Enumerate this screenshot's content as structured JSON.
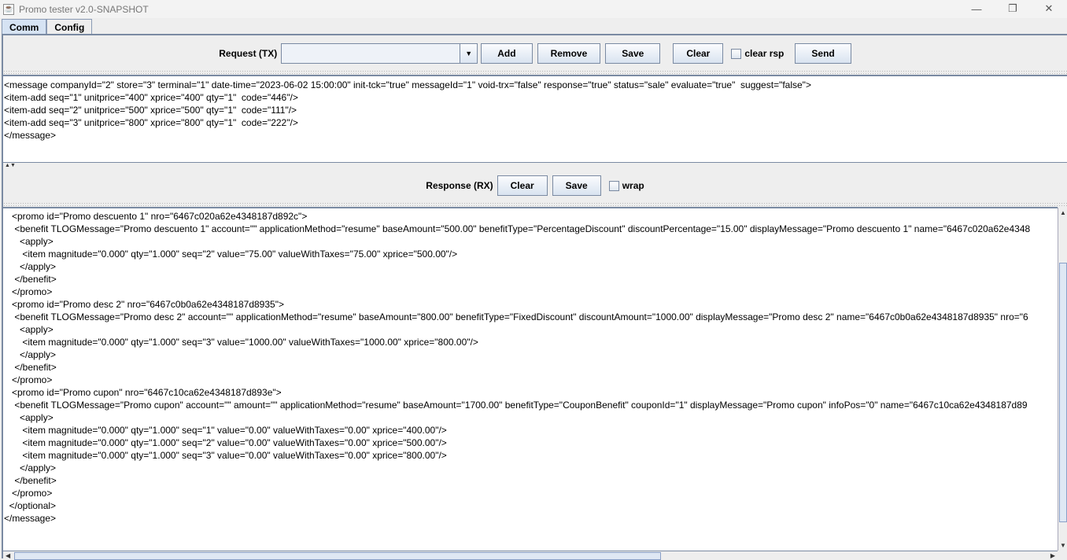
{
  "window": {
    "title": "Promo tester v2.0-SNAPSHOT",
    "minimize": "—",
    "restore": "❐",
    "close": "✕"
  },
  "tabs": [
    {
      "label": "Comm",
      "active": true
    },
    {
      "label": "Config",
      "active": false
    }
  ],
  "request": {
    "label": "Request (TX)",
    "combo_value": "",
    "buttons": {
      "add": "Add",
      "remove": "Remove",
      "save": "Save",
      "clear": "Clear",
      "send": "Send"
    },
    "clear_rsp": {
      "label": "clear rsp",
      "checked": false
    },
    "text": "<message companyId=\"2\" store=\"3\" terminal=\"1\" date-time=\"2023-06-02 15:00:00\" init-tck=\"true\" messageId=\"1\" void-trx=\"false\" response=\"true\" status=\"sale\" evaluate=\"true\"  suggest=\"false\">\n<item-add seq=\"1\" unitprice=\"400\" xprice=\"400\" qty=\"1\"  code=\"446\"/>\n<item-add seq=\"2\" unitprice=\"500\" xprice=\"500\" qty=\"1\"  code=\"111\"/>\n<item-add seq=\"3\" unitprice=\"800\" xprice=\"800\" qty=\"1\"  code=\"222\"/>\n</message>"
  },
  "response": {
    "label": "Response (RX)",
    "buttons": {
      "clear": "Clear",
      "save": "Save"
    },
    "wrap": {
      "label": "wrap",
      "checked": false
    },
    "text": "   <promo id=\"Promo descuento 1\" nro=\"6467c020a62e4348187d892c\">\n    <benefit TLOGMessage=\"Promo descuento 1\" account=\"\" applicationMethod=\"resume\" baseAmount=\"500.00\" benefitType=\"PercentageDiscount\" discountPercentage=\"15.00\" displayMessage=\"Promo descuento 1\" name=\"6467c020a62e4348\n      <apply>\n       <item magnitude=\"0.000\" qty=\"1.000\" seq=\"2\" value=\"75.00\" valueWithTaxes=\"75.00\" xprice=\"500.00\"/>\n      </apply>\n    </benefit>\n   </promo>\n   <promo id=\"Promo desc 2\" nro=\"6467c0b0a62e4348187d8935\">\n    <benefit TLOGMessage=\"Promo desc 2\" account=\"\" applicationMethod=\"resume\" baseAmount=\"800.00\" benefitType=\"FixedDiscount\" discountAmount=\"1000.00\" displayMessage=\"Promo desc 2\" name=\"6467c0b0a62e4348187d8935\" nro=\"6\n      <apply>\n       <item magnitude=\"0.000\" qty=\"1.000\" seq=\"3\" value=\"1000.00\" valueWithTaxes=\"1000.00\" xprice=\"800.00\"/>\n      </apply>\n    </benefit>\n   </promo>\n   <promo id=\"Promo cupon\" nro=\"6467c10ca62e4348187d893e\">\n    <benefit TLOGMessage=\"Promo cupon\" account=\"\" amount=\"\" applicationMethod=\"resume\" baseAmount=\"1700.00\" benefitType=\"CouponBenefit\" couponId=\"1\" displayMessage=\"Promo cupon\" infoPos=\"0\" name=\"6467c10ca62e4348187d89\n      <apply>\n       <item magnitude=\"0.000\" qty=\"1.000\" seq=\"1\" value=\"0.00\" valueWithTaxes=\"0.00\" xprice=\"400.00\"/>\n       <item magnitude=\"0.000\" qty=\"1.000\" seq=\"2\" value=\"0.00\" valueWithTaxes=\"0.00\" xprice=\"500.00\"/>\n       <item magnitude=\"0.000\" qty=\"1.000\" seq=\"3\" value=\"0.00\" valueWithTaxes=\"0.00\" xprice=\"800.00\"/>\n      </apply>\n    </benefit>\n   </promo>\n  </optional>\n</message>"
  }
}
